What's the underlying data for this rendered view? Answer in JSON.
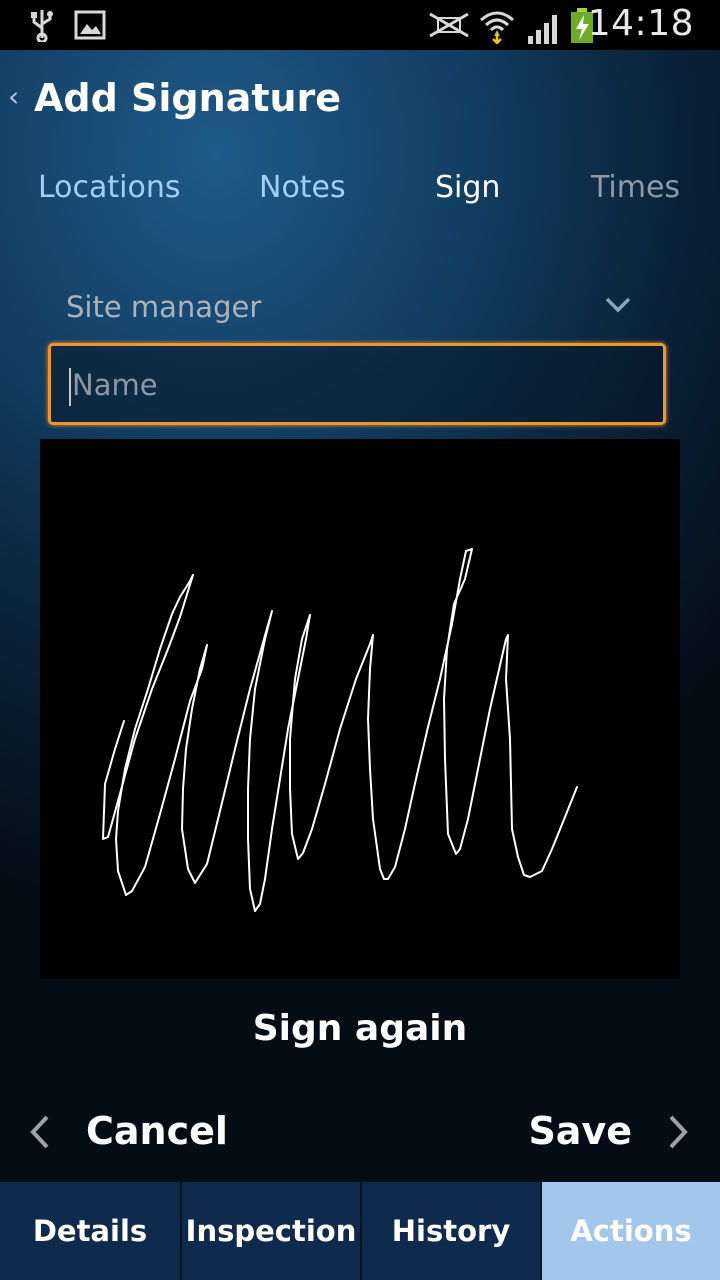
{
  "status_bar": {
    "time": "14:18",
    "icons": [
      "usb-icon",
      "image-icon",
      "mute-icon",
      "wifi-icon",
      "signal-icon",
      "battery-charging-icon"
    ]
  },
  "header": {
    "title": "Add Signature",
    "back_icon": "chevron-left-icon"
  },
  "tabs": [
    {
      "label": "Locations",
      "active": false
    },
    {
      "label": "Notes",
      "active": false
    },
    {
      "label": "Sign",
      "active": true
    },
    {
      "label": "Times",
      "active": false
    }
  ],
  "form": {
    "role_select": {
      "value": "Site manager",
      "icon": "chevron-down-icon"
    },
    "name_input": {
      "placeholder": "Name",
      "value": ""
    },
    "sign_again_label": "Sign again"
  },
  "actions": {
    "cancel_label": "Cancel",
    "save_label": "Save"
  },
  "bottom_nav": [
    {
      "label": "Details",
      "active": false
    },
    {
      "label": "Inspection",
      "active": false
    },
    {
      "label": "History",
      "active": false
    },
    {
      "label": "Actions",
      "active": true
    }
  ],
  "colors": {
    "accent_border": "#f0952a",
    "active_tab_text": "#ffffff",
    "inactive_tab_text": "#9fd0f5",
    "bottom_nav_bg": "#0f2a4c",
    "bottom_nav_active_bg": "#a3c7eb"
  }
}
